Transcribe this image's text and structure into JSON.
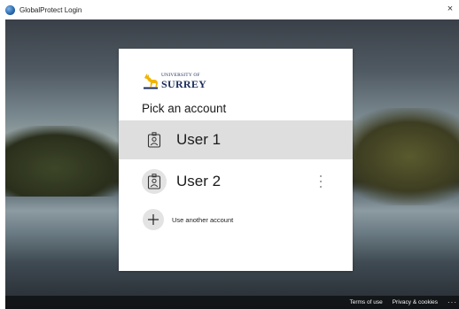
{
  "window": {
    "title": "GlobalProtect Login",
    "close_glyph": "×",
    "icon": "globalprotect-globe-icon"
  },
  "logo": {
    "line1": "UNIVERSITY OF",
    "line2": "SURREY",
    "icon": "stag-icon",
    "color": "#1a2c5a",
    "accent": "#f2b400"
  },
  "picker": {
    "heading": "Pick an account",
    "accounts": [
      {
        "name": "User 1",
        "selected": true,
        "icon": "badge-person-icon"
      },
      {
        "name": "User 2",
        "selected": false,
        "icon": "badge-person-icon",
        "menu_icon": "more-options-icon"
      }
    ],
    "add_account_label": "Use another account",
    "add_icon": "plus-icon"
  },
  "footer": {
    "terms": "Terms of use",
    "privacy": "Privacy & cookies",
    "more": "···"
  }
}
